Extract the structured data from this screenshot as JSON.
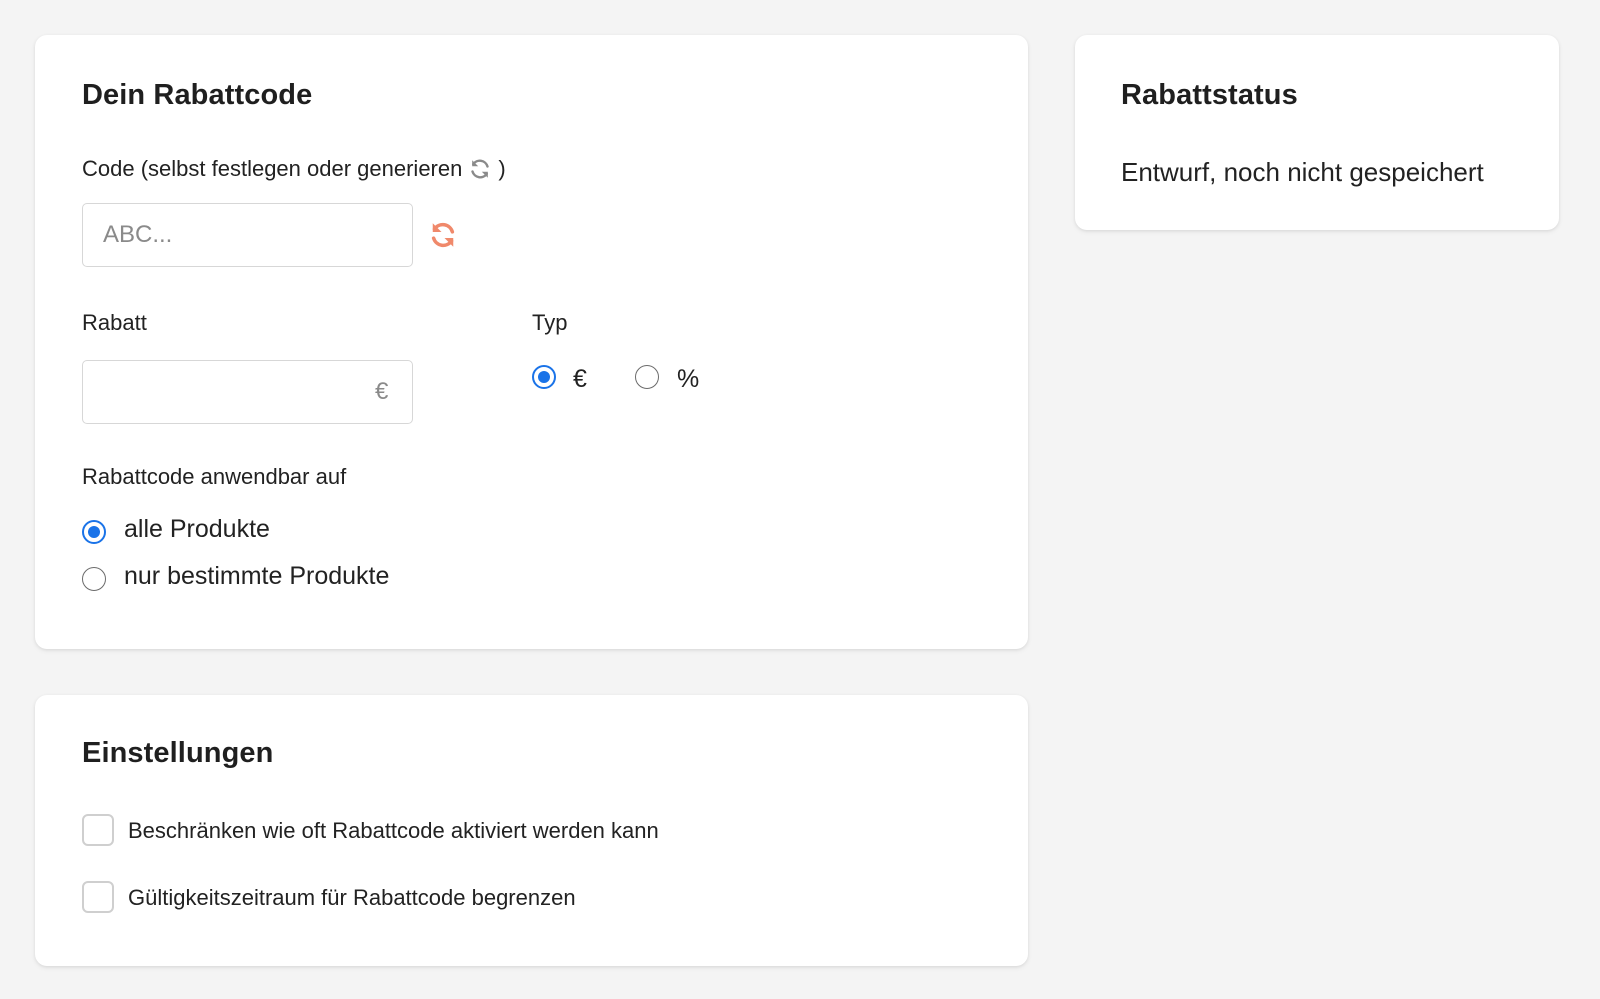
{
  "code_card": {
    "title": "Dein Rabattcode",
    "code_label_prefix": "Code (selbst festlegen oder generieren",
    "code_label_suffix": ")",
    "code_placeholder": "ABC...",
    "code_value": "",
    "refresh_icon": "refresh-icon",
    "refresh_color": "#f0896b",
    "discount_label": "Rabatt",
    "discount_value": "",
    "discount_suffix": "€",
    "type_label": "Typ",
    "type_options": [
      {
        "label": "€",
        "checked": true
      },
      {
        "label": "%",
        "checked": false
      }
    ],
    "applies_label": "Rabattcode anwendbar auf",
    "applies_options": [
      {
        "label": "alle Produkte",
        "checked": true
      },
      {
        "label": "nur bestimmte Produkte",
        "checked": false
      }
    ]
  },
  "settings_card": {
    "title": "Einstellungen",
    "options": [
      {
        "label": "Beschränken wie oft Rabattcode aktiviert werden kann",
        "checked": false
      },
      {
        "label": "Gültigkeitszeitraum für Rabattcode begrenzen",
        "checked": false
      }
    ]
  },
  "status_card": {
    "title": "Rabattstatus",
    "status": "Entwurf, noch nicht gespeichert"
  },
  "colors": {
    "accent": "#1a73e8",
    "background": "#f4f4f4"
  }
}
